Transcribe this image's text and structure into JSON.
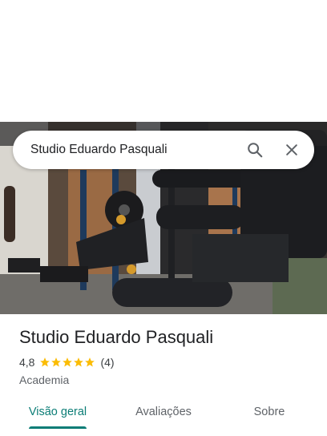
{
  "search": {
    "query": "Studio Eduardo Pasquali"
  },
  "place": {
    "name": "Studio Eduardo Pasquali",
    "rating": "4,8",
    "stars": 5,
    "review_count": "(4)",
    "category": "Academia"
  },
  "tabs": [
    {
      "label": "Visão geral",
      "active": true
    },
    {
      "label": "Avaliações",
      "active": false
    },
    {
      "label": "Sobre",
      "active": false
    }
  ],
  "colors": {
    "accent": "#0b7d76",
    "star": "#fbbc04"
  },
  "icons": {
    "search": "search-icon",
    "close": "close-icon",
    "star": "star-icon"
  }
}
